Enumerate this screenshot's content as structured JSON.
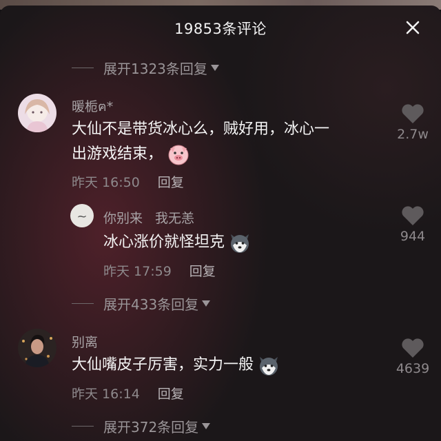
{
  "header": {
    "title": "19853条评论"
  },
  "expand_1": {
    "label": "展开1323条回复"
  },
  "comment_1": {
    "username": "暖栀ฅ*",
    "text_line1": "大仙不是带货冰心么，贼好用，冰心一",
    "text_line2": "出游戏结束，",
    "time": "昨天 16:50",
    "reply": "回复",
    "likes": "2.7w"
  },
  "reply_1": {
    "username": "你别来",
    "reply_to": "我无恙",
    "text": "冰心涨价就怪坦克",
    "time": "昨天 17:59",
    "reply": "回复",
    "likes": "944"
  },
  "expand_2": {
    "label": "展开433条回复"
  },
  "comment_2": {
    "username": "别离",
    "text": "大仙嘴皮子厉害，实力一般",
    "time": "昨天 16:14",
    "reply": "回复",
    "likes": "4639"
  },
  "expand_3": {
    "label": "展开372条回复"
  }
}
